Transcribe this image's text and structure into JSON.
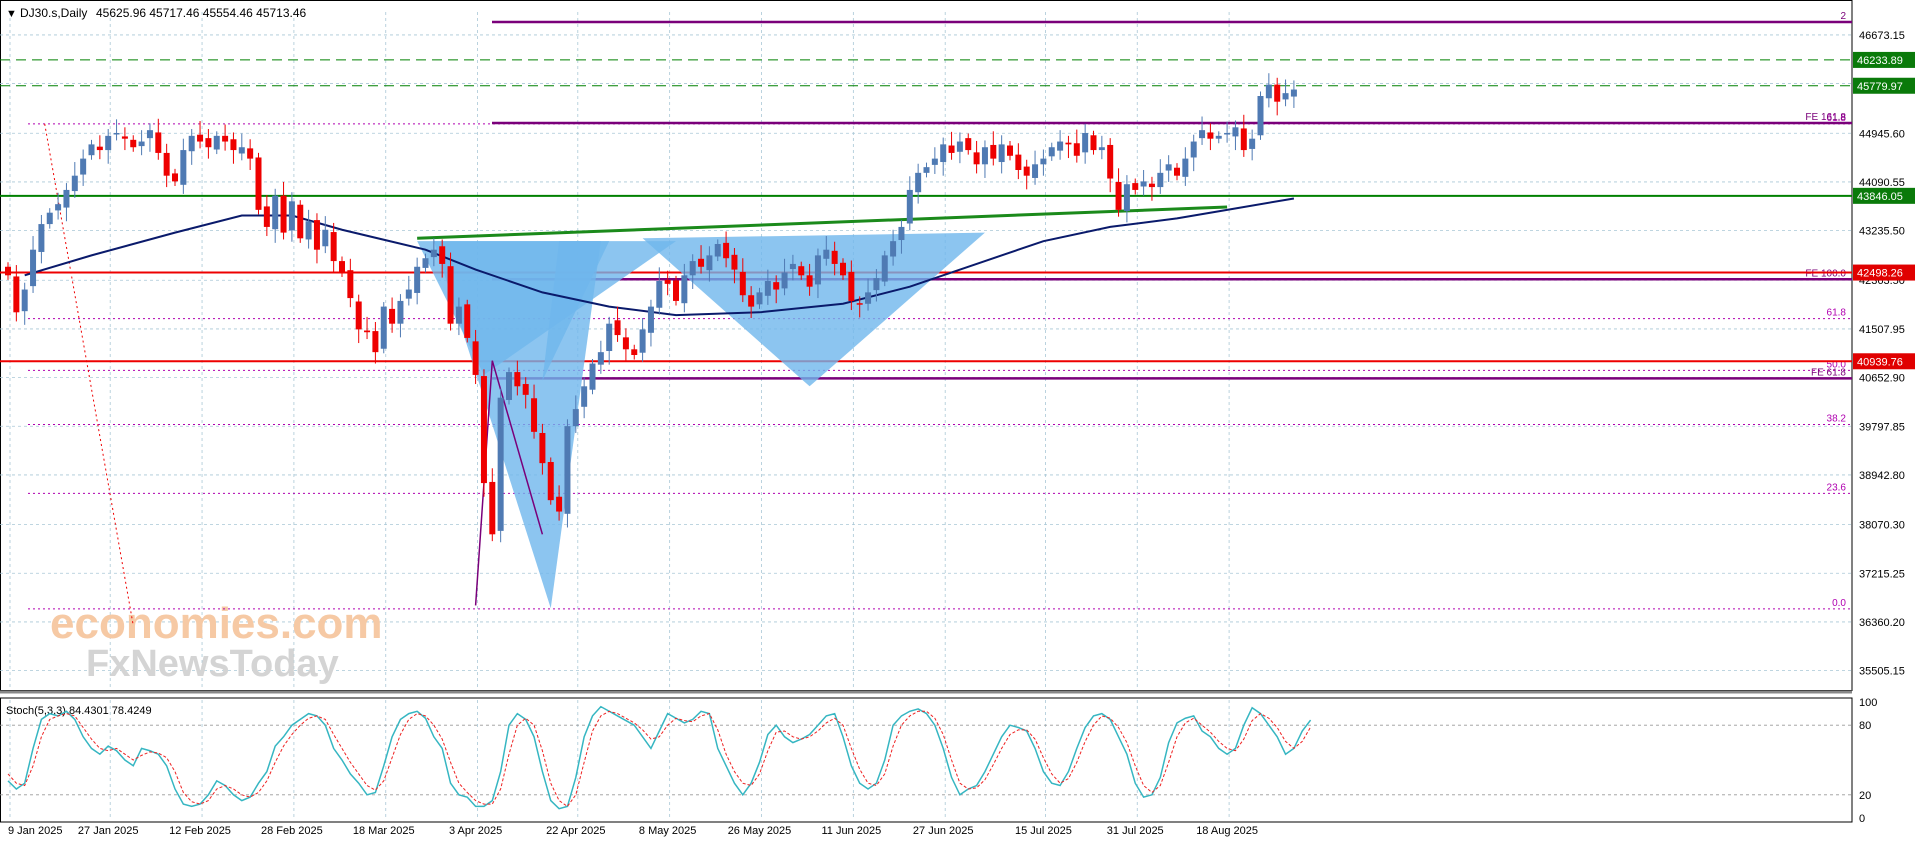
{
  "header": {
    "symbol": "DJ30.s,Daily",
    "ohlc": "45625.96 45717.46 45554.46 45713.46"
  },
  "watermark": {
    "line1": "economies.com",
    "line2": "FxNewsToday"
  },
  "colors": {
    "bull": "#4f7ab3",
    "bear": "#ee0000",
    "ma": "#0a1a6b",
    "grid": "#a9c7d6",
    "fib": "#b000b0",
    "fe": "#7a007a",
    "support_green": "#008000",
    "pattern": "#6fb6ec",
    "stoch_k": "#36b6c2",
    "stoch_d": "#ee2222"
  },
  "chart_data": [
    {
      "type": "candlestick",
      "title": "DJ30.s,Daily",
      "ylim": [
        35200,
        46900
      ],
      "y_ticks": [
        "46673.15",
        "45818.60",
        "44945.60",
        "44090.55",
        "43235.50",
        "42363.50",
        "41507.95",
        "40652.90",
        "39797.85",
        "38942.80",
        "38070.30",
        "37215.25",
        "36360.20",
        "35505.15"
      ],
      "x_ticks": [
        "9 Jan 2025",
        "27 Jan 2025",
        "12 Feb 2025",
        "28 Feb 2025",
        "18 Mar 2025",
        "3 Apr 2025",
        "22 Apr 2025",
        "8 May 2025",
        "26 May 2025",
        "11 Jun 2025",
        "27 Jun 2025",
        "15 Jul 2025",
        "31 Jul 2025",
        "18 Aug 2025"
      ],
      "x_tick_index": [
        0,
        12,
        23,
        34,
        45,
        56,
        68,
        79,
        90,
        101,
        112,
        124,
        135,
        146
      ],
      "closes": [
        42450,
        41800,
        42200,
        42900,
        43350,
        43550,
        43700,
        43950,
        44200,
        44500,
        44750,
        44650,
        44900,
        44950,
        44850,
        44700,
        44800,
        45000,
        44600,
        44200,
        44100,
        44650,
        44900,
        44800,
        44700,
        44900,
        44800,
        44650,
        44700,
        44500,
        43600,
        43300,
        43850,
        43200,
        43750,
        43100,
        43400,
        42900,
        43250,
        42700,
        42500,
        42050,
        41500,
        41450,
        41100,
        41900,
        41600,
        42000,
        42200,
        42600,
        42750,
        42900,
        42650,
        41600,
        41900,
        41350,
        40700,
        38800,
        37900,
        40300,
        40750,
        40500,
        40350,
        39700,
        39150,
        38500,
        38300,
        39800,
        40100,
        40500,
        40900,
        41100,
        41600,
        41400,
        41150,
        41050,
        41500,
        41900,
        42350,
        42300,
        42000,
        42450,
        42700,
        42600,
        42800,
        43000,
        42750,
        42550,
        42100,
        41900,
        42150,
        42350,
        42200,
        42500,
        42650,
        42450,
        42250,
        42800,
        42900,
        42650,
        42450,
        42000,
        41950,
        42150,
        42400,
        42800,
        43050,
        43300,
        43950,
        44250,
        44350,
        44500,
        44750,
        44600,
        44800,
        44650,
        44400,
        44700,
        44500,
        44750,
        44550,
        44300,
        44200,
        44400,
        44500,
        44700,
        44800,
        44750,
        44550,
        44950,
        44650,
        44700,
        44150,
        43600,
        44050,
        43950,
        44100,
        44000,
        44250,
        44400,
        44200,
        44500,
        44800,
        45000,
        44850,
        44900,
        44950,
        45050,
        44650,
        44850,
        45600,
        45800,
        45500,
        45650,
        45713.46
      ],
      "ma_line": {
        "name": "MA",
        "start_idx": 2,
        "points": [
          [
            2,
            42450
          ],
          [
            10,
            42800
          ],
          [
            20,
            43200
          ],
          [
            28,
            43500
          ],
          [
            34,
            43500
          ],
          [
            40,
            43250
          ],
          [
            50,
            42900
          ],
          [
            56,
            42550
          ],
          [
            64,
            42150
          ],
          [
            72,
            41900
          ],
          [
            80,
            41750
          ],
          [
            90,
            41800
          ],
          [
            100,
            41950
          ],
          [
            108,
            42250
          ],
          [
            116,
            42650
          ],
          [
            124,
            43050
          ],
          [
            132,
            43300
          ],
          [
            140,
            43450
          ],
          [
            146,
            43600
          ],
          [
            154,
            43800
          ]
        ]
      },
      "horizontal_levels": [
        {
          "value": 46233.89,
          "label": "46233.89",
          "style": "dashed-green"
        },
        {
          "value": 45779.97,
          "label": "45779.97",
          "style": "dashed-green"
        },
        {
          "value": 43846.05,
          "label": "43846.05",
          "style": "solid-green"
        },
        {
          "value": 42498.26,
          "label": "42498.26",
          "style": "solid-red"
        },
        {
          "value": 40939.76,
          "label": "40939.76",
          "style": "solid-red"
        }
      ],
      "fe_levels": [
        {
          "value": 46900,
          "label": "2"
        },
        {
          "value": 45125,
          "label": "FE 161.8"
        },
        {
          "value": 42380,
          "label": "FE 100.0"
        },
        {
          "value": 40640,
          "label": "FE 61.8"
        }
      ],
      "fib_levels": [
        {
          "value": 45110,
          "label": "61.8"
        },
        {
          "value": 41690,
          "label": "61.8"
        },
        {
          "value": 40780,
          "label": "50.0"
        },
        {
          "value": 39830,
          "label": "38.2"
        },
        {
          "value": 38620,
          "label": "23.6"
        },
        {
          "value": 36590,
          "label": "0.0"
        }
      ]
    },
    {
      "type": "line",
      "title": "Stoch(5,3,3) 84.4301 78.4249",
      "ylim": [
        0,
        100
      ],
      "y_ticks": [
        "100",
        "80",
        "20",
        "0"
      ],
      "series": [
        {
          "name": "%K",
          "values": [
            32,
            25,
            30,
            60,
            85,
            90,
            88,
            92,
            85,
            70,
            60,
            55,
            62,
            58,
            50,
            45,
            60,
            58,
            55,
            45,
            25,
            12,
            10,
            12,
            20,
            32,
            28,
            20,
            15,
            18,
            30,
            40,
            62,
            70,
            80,
            85,
            90,
            88,
            80,
            60,
            50,
            38,
            30,
            20,
            22,
            45,
            70,
            85,
            90,
            92,
            86,
            70,
            60,
            30,
            20,
            18,
            10,
            10,
            15,
            40,
            80,
            90,
            85,
            70,
            40,
            15,
            8,
            10,
            35,
            70,
            88,
            96,
            92,
            88,
            84,
            80,
            70,
            60,
            75,
            90,
            86,
            82,
            85,
            92,
            90,
            60,
            45,
            30,
            20,
            30,
            48,
            72,
            80,
            70,
            65,
            68,
            72,
            80,
            88,
            90,
            70,
            45,
            30,
            25,
            30,
            50,
            80,
            88,
            92,
            94,
            90,
            80,
            60,
            35,
            20,
            25,
            28,
            40,
            55,
            70,
            80,
            78,
            75,
            60,
            40,
            30,
            28,
            40,
            60,
            78,
            88,
            90,
            85,
            70,
            55,
            30,
            18,
            20,
            35,
            65,
            82,
            86,
            88,
            75,
            70,
            60,
            55,
            60,
            80,
            95,
            90,
            80,
            70,
            55,
            60,
            75,
            84.43
          ]
        },
        {
          "name": "%D",
          "values": [
            38,
            30,
            28,
            45,
            70,
            85,
            88,
            90,
            88,
            78,
            68,
            60,
            58,
            60,
            55,
            50,
            54,
            57,
            56,
            52,
            40,
            22,
            14,
            12,
            15,
            25,
            28,
            25,
            20,
            18,
            22,
            32,
            48,
            62,
            72,
            80,
            86,
            88,
            85,
            72,
            60,
            48,
            38,
            28,
            24,
            32,
            52,
            72,
            85,
            90,
            88,
            80,
            68,
            48,
            30,
            22,
            15,
            12,
            12,
            25,
            55,
            80,
            86,
            80,
            58,
            30,
            15,
            10,
            20,
            48,
            75,
            88,
            92,
            90,
            86,
            82,
            76,
            68,
            70,
            80,
            86,
            84,
            83,
            88,
            90,
            76,
            55,
            40,
            30,
            28,
            38,
            58,
            74,
            75,
            70,
            68,
            70,
            75,
            82,
            86,
            80,
            60,
            42,
            30,
            28,
            38,
            62,
            80,
            88,
            92,
            92,
            86,
            72,
            50,
            30,
            25,
            26,
            33,
            46,
            60,
            72,
            76,
            76,
            68,
            52,
            38,
            30,
            34,
            48,
            66,
            80,
            88,
            86,
            78,
            65,
            45,
            28,
            22,
            28,
            48,
            70,
            82,
            86,
            80,
            74,
            66,
            60,
            58,
            68,
            84,
            90,
            86,
            78,
            66,
            60,
            66,
            78.42
          ]
        }
      ]
    }
  ]
}
